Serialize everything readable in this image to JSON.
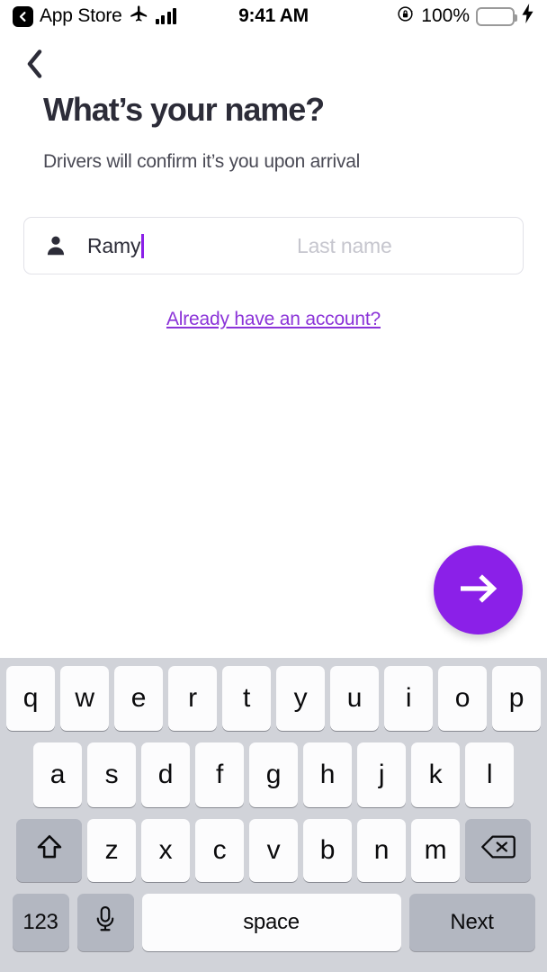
{
  "status_bar": {
    "back_label": "App Store",
    "back_icon": "back-chevron-icon",
    "airplane_icon": "airplane-mode-icon",
    "signal_icon": "cellular-signal-icon",
    "time": "9:41 AM",
    "rotation_lock_icon": "rotation-lock-icon",
    "battery_percent": "100%",
    "battery_icon": "battery-icon",
    "charging_icon": "lightning-bolt-icon",
    "battery_color": "#4CD662"
  },
  "nav": {
    "back_icon": "chevron-left-icon"
  },
  "screen": {
    "title": "What’s your name?",
    "subtitle": "Drivers will confirm it’s you upon arrival"
  },
  "name_field": {
    "icon": "person-icon",
    "first_name_value": "Ramy",
    "last_name_placeholder": "Last name",
    "caret_color": "#8B20E8",
    "border_color": "#E2E2E8"
  },
  "account_link": {
    "label": "Already have an account?",
    "color": "#8B33D8"
  },
  "next_fab": {
    "icon": "arrow-right-icon",
    "background": "#8B20E8"
  },
  "keyboard": {
    "background": "#D1D3D9",
    "row1": [
      "q",
      "w",
      "e",
      "r",
      "t",
      "y",
      "u",
      "i",
      "o",
      "p"
    ],
    "row2": [
      "a",
      "s",
      "d",
      "f",
      "g",
      "h",
      "j",
      "k",
      "l"
    ],
    "row3": [
      "z",
      "x",
      "c",
      "v",
      "b",
      "n",
      "m"
    ],
    "shift_icon": "shift-arrow-icon",
    "delete_icon": "backspace-icon",
    "numbers_label": "123",
    "mic_icon": "microphone-icon",
    "space_label": "space",
    "return_label": "Next"
  }
}
